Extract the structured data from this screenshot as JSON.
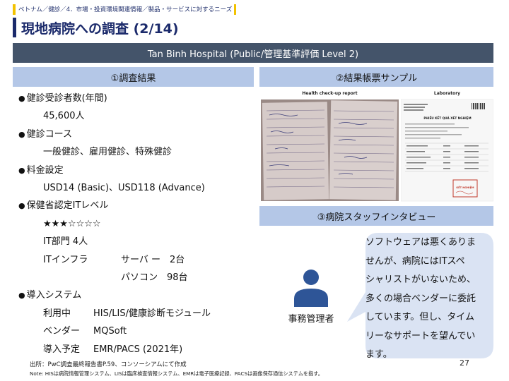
{
  "breadcrumb": "ベトナム／健診／4．市場・投資環境関連情報／製品・サービスに対するニーズ",
  "title": "現地病院への調査 (2/14)",
  "hospital_banner": "Tan Binh Hospital (Public/管理基準評価 Level 2)",
  "sections": {
    "results_header": "①調査結果",
    "sample_header": "②結果帳票サンプル",
    "interview_header": "③病院スタッフインタビュー"
  },
  "results": {
    "visitors_label": "健診受診者数(年間)",
    "visitors_value": "45,600人",
    "course_label": "健診コース",
    "course_value": "一般健診、雇用健診、特殊健診",
    "price_label": "料金設定",
    "price_value": "USD14 (Basic)、USD118 (Advance)",
    "it_level_label": "保健省認定ITレベル",
    "it_level_stars": "★★★☆☆☆☆",
    "it_dept": "IT部門  4人",
    "it_infra_label": "ITインフラ",
    "server": "サーバ ー　2台",
    "pc": "パソコン　98台",
    "system_label": "導入システム",
    "in_use_label": "利用中",
    "in_use_value": "HIS/LIS/健康診断モジュール",
    "vendor_label": "ベンダー",
    "vendor_value": "MQSoft",
    "planned_label": "導入予定",
    "planned_value": "EMR/PACS (2021年)"
  },
  "sample": {
    "report1_title": "Health check-up report",
    "report2_title": "Laboratory",
    "report2_heading": "PHIẾU KẾT QUẢ XÉT NGHIỆM",
    "stamp_text": "KẾT NGHIỆM"
  },
  "interview": {
    "role": "事務管理者",
    "quote_lines": [
      "ソフトウェアは悪くありま",
      "せんが、病院にはITスペ",
      "シャリストがいないため、",
      "多くの場合ベンダーに委託",
      "しています。但し、タイム",
      "リーなサポートを望んでい",
      "ます。"
    ]
  },
  "footer": {
    "source": "出所：PwC調査最終報告書P.59、コンソーシアムにて作成",
    "note": "Note: HISは病院情報管理システム、LISは臨床検査情報システム、EMRは電子医療記録、PACSは画像保存通信システムを指す。",
    "page_number": "27"
  },
  "colors": {
    "navy": "#1b2a6b",
    "accent_yellow": "#f2c200",
    "banner": "#44546a",
    "section_header": "#b4c7e7",
    "bubble": "#dae3f3",
    "icon": "#2e5597"
  }
}
